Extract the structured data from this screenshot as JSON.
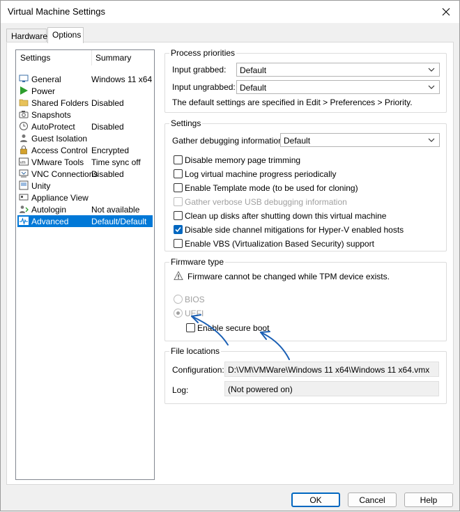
{
  "window": {
    "title": "Virtual Machine Settings"
  },
  "tabs": [
    {
      "label": "Hardware"
    },
    {
      "label": "Options"
    }
  ],
  "list": {
    "col_settings": "Settings",
    "col_summary": "Summary",
    "items": [
      {
        "label": "General",
        "summary": "Windows 11 x64",
        "icon": "monitor-icon"
      },
      {
        "label": "Power",
        "summary": "",
        "icon": "play-icon"
      },
      {
        "label": "Shared Folders",
        "summary": "Disabled",
        "icon": "folder-icon"
      },
      {
        "label": "Snapshots",
        "summary": "",
        "icon": "snapshot-icon"
      },
      {
        "label": "AutoProtect",
        "summary": "Disabled",
        "icon": "clock-icon"
      },
      {
        "label": "Guest Isolation",
        "summary": "",
        "icon": "user-icon"
      },
      {
        "label": "Access Control",
        "summary": "Encrypted",
        "icon": "lock-icon"
      },
      {
        "label": "VMware Tools",
        "summary": "Time sync off",
        "icon": "vm-icon"
      },
      {
        "label": "VNC Connections",
        "summary": "Disabled",
        "icon": "vnc-icon"
      },
      {
        "label": "Unity",
        "summary": "",
        "icon": "unity-icon"
      },
      {
        "label": "Appliance View",
        "summary": "",
        "icon": "appliance-icon"
      },
      {
        "label": "Autologin",
        "summary": "Not available",
        "icon": "autologin-icon"
      },
      {
        "label": "Advanced",
        "summary": "Default/Default",
        "icon": "advanced-icon"
      }
    ]
  },
  "process_priorities": {
    "title": "Process priorities",
    "grabbed_label": "Input grabbed:",
    "grabbed_value": "Default",
    "ungrabbed_label": "Input ungrabbed:",
    "ungrabbed_value": "Default",
    "note": "The default settings are specified in Edit > Preferences > Priority."
  },
  "settings": {
    "title": "Settings",
    "debug_label": "Gather debugging information:",
    "debug_value": "Default",
    "checkboxes": [
      {
        "label": "Disable memory page trimming",
        "checked": false,
        "disabled": false
      },
      {
        "label": "Log virtual machine progress periodically",
        "checked": false,
        "disabled": false
      },
      {
        "label": "Enable Template mode (to be used for cloning)",
        "checked": false,
        "disabled": false
      },
      {
        "label": "Gather verbose USB debugging information",
        "checked": false,
        "disabled": true
      },
      {
        "label": "Clean up disks after shutting down this virtual machine",
        "checked": false,
        "disabled": false
      },
      {
        "label": "Disable side channel mitigations for Hyper-V enabled hosts",
        "checked": true,
        "disabled": false
      },
      {
        "label": "Enable VBS (Virtualization Based Security) support",
        "checked": false,
        "disabled": false
      }
    ]
  },
  "firmware": {
    "title": "Firmware type",
    "warning": "Firmware cannot be changed while TPM device exists.",
    "bios_label": "BIOS",
    "uefi_label": "UEFI",
    "secure_boot_label": "Enable secure boot"
  },
  "file_locations": {
    "title": "File locations",
    "config_label": "Configuration:",
    "config_value": "D:\\VM\\VMWare\\Windows 11 x64\\Windows 11 x64.vmx",
    "log_label": "Log:",
    "log_value": "(Not powered on)"
  },
  "buttons": {
    "ok": "OK",
    "cancel": "Cancel",
    "help": "Help"
  },
  "colors": {
    "selection": "#0078d7",
    "checkbox_checked": "#0067c0",
    "annotation_arrow": "#1a5fb4"
  }
}
